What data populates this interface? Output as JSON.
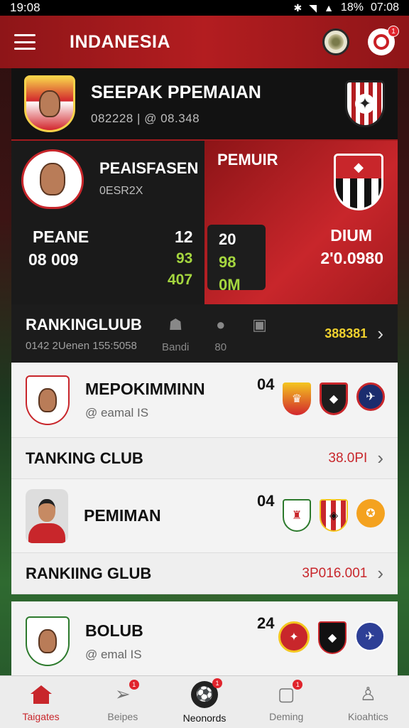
{
  "status_bar": {
    "time_left": "19:08",
    "battery": "18%",
    "time_right": "07:08"
  },
  "app_bar": {
    "title": "INDANESIA",
    "notif_count": "1"
  },
  "hero": {
    "title": "SEEPAK PPEMAIAN",
    "subtitle": "082228 | @ 08.348"
  },
  "match": {
    "left": {
      "player_name": "PEAISFASEN",
      "player_sub": "0ESR2X",
      "team": "PEANE",
      "code": "08 009",
      "n1": "12",
      "n2": "93",
      "n3": "407"
    },
    "right": {
      "label": "PEMUIR",
      "box_top": "20",
      "box_mid": "98",
      "box_bot": "0M",
      "team": "DIUM",
      "code": "2'0.0980"
    }
  },
  "ranking_dark": {
    "title": "RANKINGLUUB",
    "subtitle": "0142 2Uenen 155:5058",
    "mini1_label": "Bandi",
    "mini2_label": "80",
    "value": "388381"
  },
  "club_rows": [
    {
      "name": "MEPOKIMMINN",
      "email": "@ eamal IS",
      "num": "04"
    },
    {
      "name": "PEMIMAN",
      "email": "",
      "num": "04"
    },
    {
      "name": "BOLUB",
      "email": "@ emal IS",
      "num": "24"
    }
  ],
  "rank_rows": [
    {
      "title": "TANKING CLUB",
      "value": "38.0PI"
    },
    {
      "title": "RANKIING GLUB",
      "value": "3P016.001"
    }
  ],
  "bottom_nav": [
    {
      "label": "Taigates"
    },
    {
      "label": "Beipes",
      "badge": "1"
    },
    {
      "label": "Neonords",
      "badge": "1"
    },
    {
      "label": "Deming",
      "badge": "1"
    },
    {
      "label": "Kioahtics"
    }
  ],
  "colors": {
    "brand_red": "#c8262b",
    "accent_green": "#a5d63f",
    "accent_yellow": "#f1d22e"
  }
}
